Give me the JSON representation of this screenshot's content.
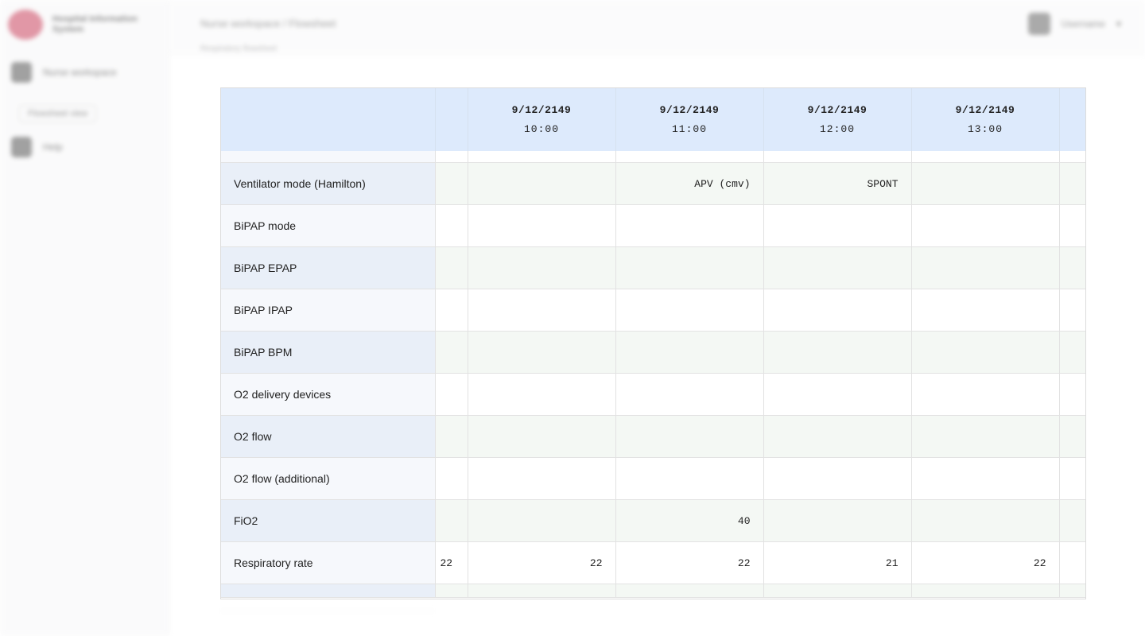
{
  "app": {
    "logo_text": "Hospital Information System",
    "breadcrumb": "Nurse workspace / Flowsheet",
    "subcrumb": "Respiratory flowsheet",
    "user_label": "Username"
  },
  "sidebar": {
    "items": [
      {
        "label": "Nurse workspace",
        "icon": "home-icon"
      },
      {
        "label": "Flowsheet view",
        "icon": "list-icon"
      },
      {
        "label": "Help",
        "icon": "help-icon"
      }
    ]
  },
  "table": {
    "columns": [
      {
        "date": "",
        "time": ""
      },
      {
        "date": "9/12/2149",
        "time": "10:00"
      },
      {
        "date": "9/12/2149",
        "time": "11:00"
      },
      {
        "date": "9/12/2149",
        "time": "12:00"
      },
      {
        "date": "9/12/2149",
        "time": "13:00"
      },
      {
        "date": "",
        "time": ""
      }
    ],
    "rows": [
      {
        "label": "Ventilator mode (Hamilton)",
        "values": [
          "",
          "",
          "APV (cmv)",
          "SPONT",
          "",
          ""
        ]
      },
      {
        "label": "BiPAP mode",
        "values": [
          "",
          "",
          "",
          "",
          "",
          ""
        ]
      },
      {
        "label": "BiPAP EPAP",
        "values": [
          "",
          "",
          "",
          "",
          "",
          ""
        ]
      },
      {
        "label": "BiPAP IPAP",
        "values": [
          "",
          "",
          "",
          "",
          "",
          ""
        ]
      },
      {
        "label": "BiPAP BPM",
        "values": [
          "",
          "",
          "",
          "",
          "",
          ""
        ]
      },
      {
        "label": "O2 delivery devices",
        "values": [
          "",
          "",
          "",
          "",
          "",
          ""
        ]
      },
      {
        "label": "O2 flow",
        "values": [
          "",
          "",
          "",
          "",
          "",
          ""
        ]
      },
      {
        "label": "O2 flow (additional)",
        "values": [
          "",
          "",
          "",
          "",
          "",
          ""
        ]
      },
      {
        "label": "FiO2",
        "values": [
          "",
          "",
          "40",
          "",
          "",
          ""
        ]
      },
      {
        "label": "Respiratory rate",
        "values": [
          "22",
          "22",
          "22",
          "21",
          "22",
          ""
        ]
      }
    ]
  },
  "colors": {
    "header_bg": "#ddeafc",
    "row_alt_bg": "#f4f8f4",
    "label_bg": "#f6f8fc"
  }
}
